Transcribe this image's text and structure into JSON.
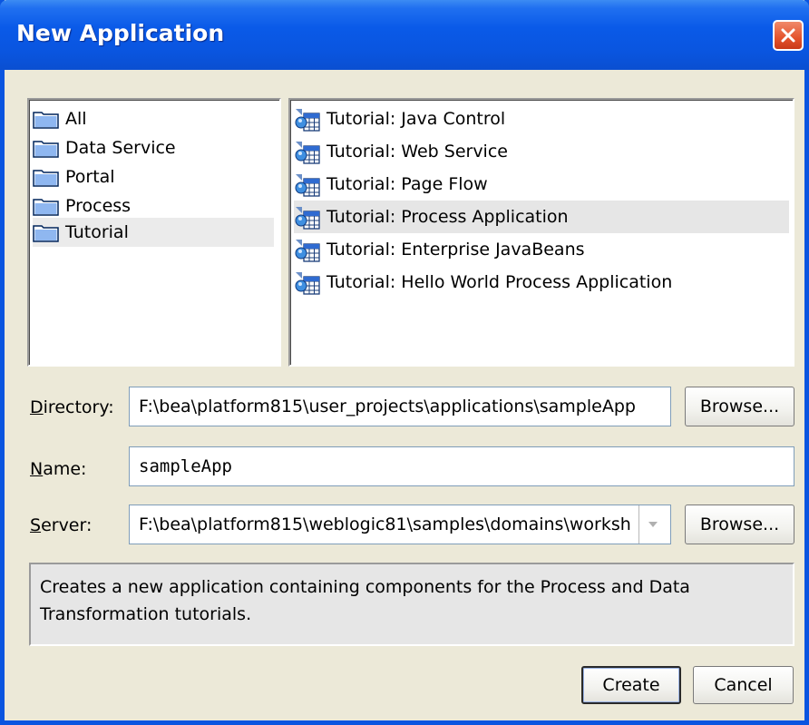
{
  "window": {
    "title": "New Application"
  },
  "categories": [
    {
      "label": "All",
      "selected": false,
      "icon": "folder-icon"
    },
    {
      "label": "Data Service",
      "selected": false,
      "icon": "folder-icon"
    },
    {
      "label": "Portal",
      "selected": false,
      "icon": "folder-icon"
    },
    {
      "label": "Process",
      "selected": false,
      "icon": "folder-icon"
    },
    {
      "label": "Tutorial",
      "selected": true,
      "icon": "folder-icon"
    }
  ],
  "templates": [
    {
      "label": "Tutorial: Java Control",
      "selected": false,
      "icon": "application-template-icon"
    },
    {
      "label": "Tutorial: Web Service",
      "selected": false,
      "icon": "application-template-icon"
    },
    {
      "label": "Tutorial: Page Flow",
      "selected": false,
      "icon": "application-template-icon"
    },
    {
      "label": "Tutorial: Process Application",
      "selected": true,
      "icon": "application-template-icon"
    },
    {
      "label": "Tutorial: Enterprise JavaBeans",
      "selected": false,
      "icon": "application-template-icon"
    },
    {
      "label": "Tutorial: Hello World Process Application",
      "selected": false,
      "icon": "application-template-icon"
    }
  ],
  "form": {
    "directory_label_mnemonic": "D",
    "directory_label_rest": "irectory:",
    "directory_value": "F:\\bea\\platform815\\user_projects\\applications\\sampleApp",
    "name_label_mnemonic": "N",
    "name_label_rest": "ame:",
    "name_value": "sampleApp",
    "server_label_mnemonic": "S",
    "server_label_rest": "erver:",
    "server_value": "F:\\bea\\platform815\\weblogic81\\samples\\domains\\worksh",
    "browse_label": "Browse..."
  },
  "description": "Creates a new application containing components for the Process and Data Transformation tutorials.",
  "actions": {
    "create_label": "Create",
    "cancel_label": "Cancel"
  },
  "colors": {
    "titlebar": "#0a55e0",
    "close": "#e4532c",
    "selection": "#ebebeb"
  }
}
